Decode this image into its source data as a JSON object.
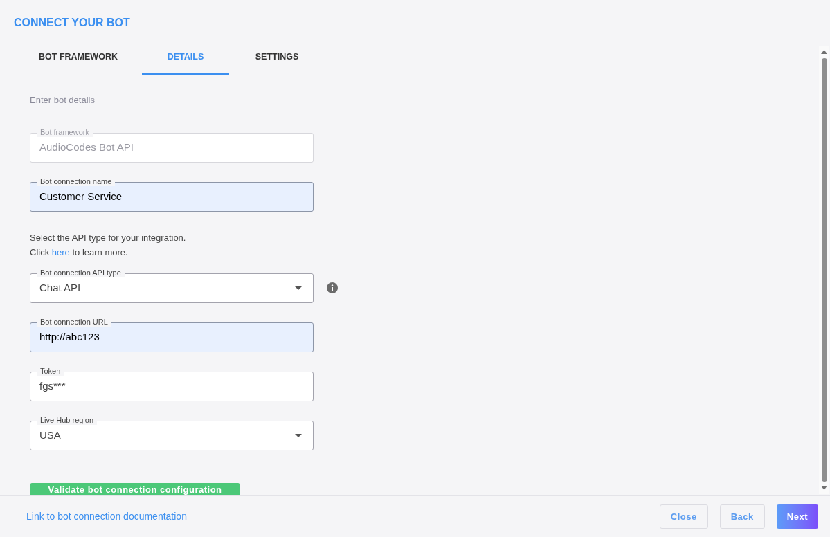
{
  "dialog": {
    "title": "CONNECT YOUR BOT"
  },
  "tabs": [
    {
      "label": "BOT FRAMEWORK",
      "selected": false
    },
    {
      "label": "DETAILS",
      "selected": true
    },
    {
      "label": "SETTINGS",
      "selected": false
    }
  ],
  "intro": "Enter bot details",
  "fields_top": [
    {
      "kind": "text",
      "label": "Bot framework",
      "value": "AudioCodes Bot API",
      "disabled": true,
      "highlighted": false
    },
    {
      "kind": "text",
      "label": "Bot connection name",
      "value": "Customer Service",
      "disabled": false,
      "highlighted": true
    }
  ],
  "api_hint": {
    "line_1": "Select the API type for your integration.",
    "line_2_before": "Click",
    "link": "here",
    "line_2_after": "to learn more."
  },
  "fields_bottom": [
    {
      "kind": "select",
      "label": "Bot connection API type",
      "value": "Chat API",
      "disabled": false,
      "highlighted": false,
      "info": true
    },
    {
      "kind": "text",
      "label": "Bot connection URL",
      "value": "http://abc123",
      "disabled": false,
      "highlighted": true,
      "info": false
    },
    {
      "kind": "text",
      "label": "Token",
      "value": "fgs***",
      "disabled": false,
      "highlighted": false,
      "info": false
    },
    {
      "kind": "select",
      "label": "Live Hub region",
      "value": "USA",
      "disabled": false,
      "highlighted": false,
      "info": false
    }
  ],
  "validate_button": "Validate bot connection configuration",
  "footer": {
    "doc_link": "Link to bot connection documentation",
    "buttons": [
      {
        "label": "Close",
        "kind": "outline"
      },
      {
        "label": "Back",
        "kind": "outline"
      },
      {
        "label": "Next",
        "kind": "primary"
      }
    ]
  }
}
